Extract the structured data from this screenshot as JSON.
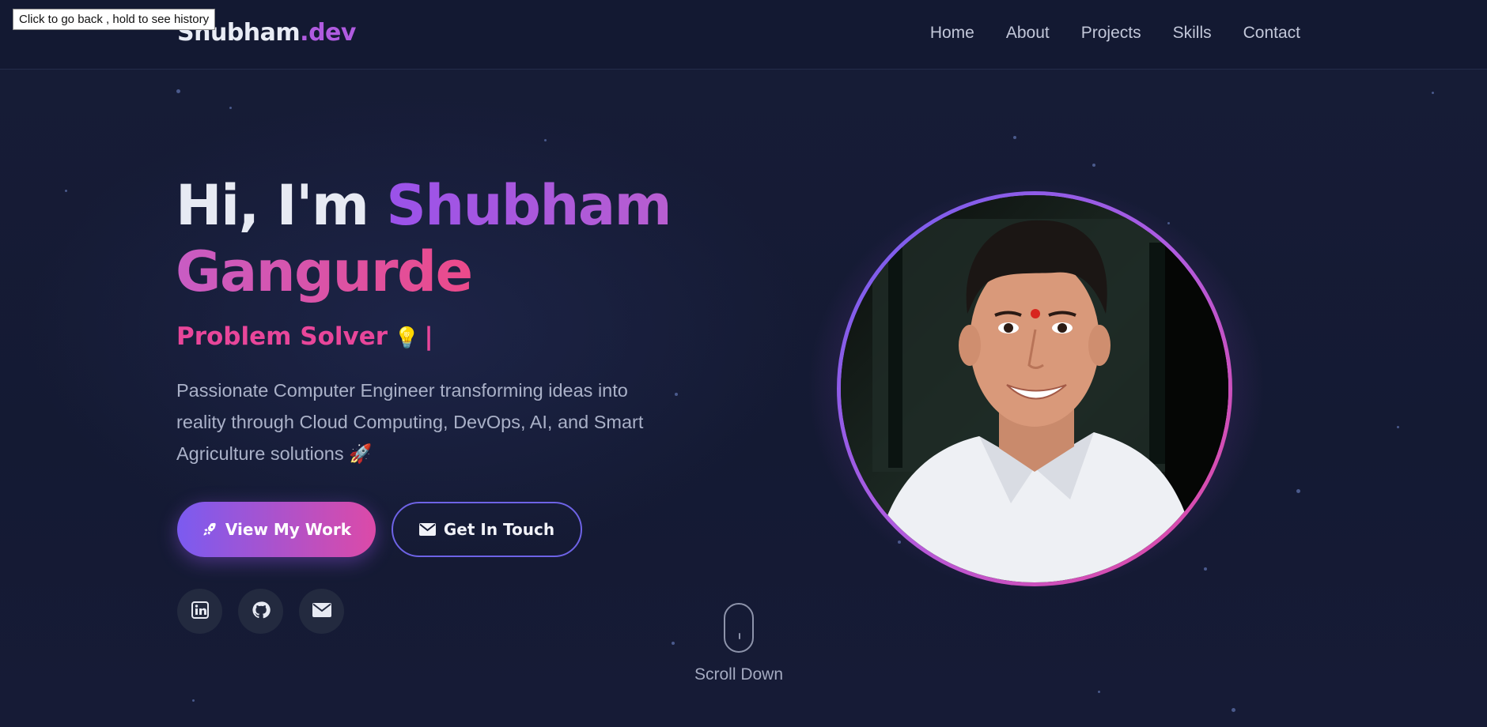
{
  "tooltip": "Click to go back , hold to see history",
  "nav": {
    "brand_main": "Shubham",
    "brand_suffix": ".dev",
    "links": [
      "Home",
      "About",
      "Projects",
      "Skills",
      "Contact"
    ]
  },
  "hero": {
    "greeting": "Hi, I'm ",
    "first_name": "Shubham",
    "last_name": "Gangurde",
    "role": "Problem Solver",
    "role_emoji": "💡",
    "role_cursor": "|",
    "description": "Passionate Computer Engineer transforming ideas into reality through Cloud Computing, DevOps, AI, and Smart Agriculture solutions 🚀",
    "primary_button": "View My Work",
    "secondary_button": "Get In Touch",
    "socials": [
      "linkedin-icon",
      "github-icon",
      "mail-icon"
    ]
  },
  "scroll": {
    "label": "Scroll Down"
  },
  "colors": {
    "accent_purple": "#9a52ea",
    "accent_pink": "#e8469a",
    "background": "#151a33"
  }
}
